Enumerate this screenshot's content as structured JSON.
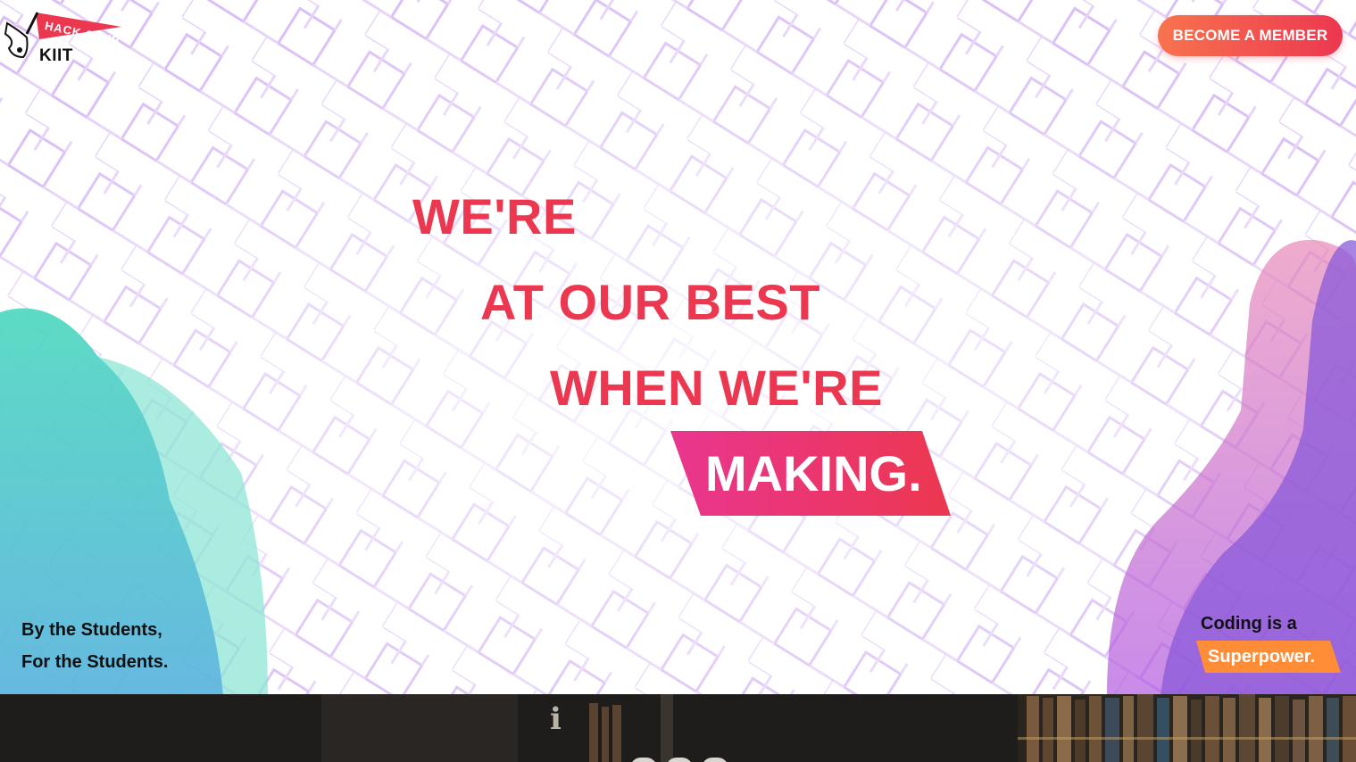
{
  "brand": {
    "pennant_text": "HACK CLUB",
    "name": "KIIT",
    "logo_icon": "hack-club-pennant-icon"
  },
  "header": {
    "cta_label": "BECOME A MEMBER"
  },
  "hero": {
    "line1": "WE'RE",
    "line2": "AT OUR BEST",
    "line3": "WHEN WE'RE",
    "line4": "MAKING."
  },
  "taglines": {
    "left_line1": "By the Students,",
    "left_line2": "For the Students.",
    "right_line1": "Coding is a",
    "right_highlight": "Superpower."
  },
  "colors": {
    "accent_red": "#ec3750",
    "accent_pink": "#e92f8f",
    "accent_orange": "#ff8c37",
    "pattern_purple": "#c9a3f0",
    "blob_teal": "#3cc9b4",
    "blob_purple": "#9b4de0"
  },
  "section_below": {
    "background_icon": "library-bookshelf-image",
    "carousel_dots": 3
  }
}
